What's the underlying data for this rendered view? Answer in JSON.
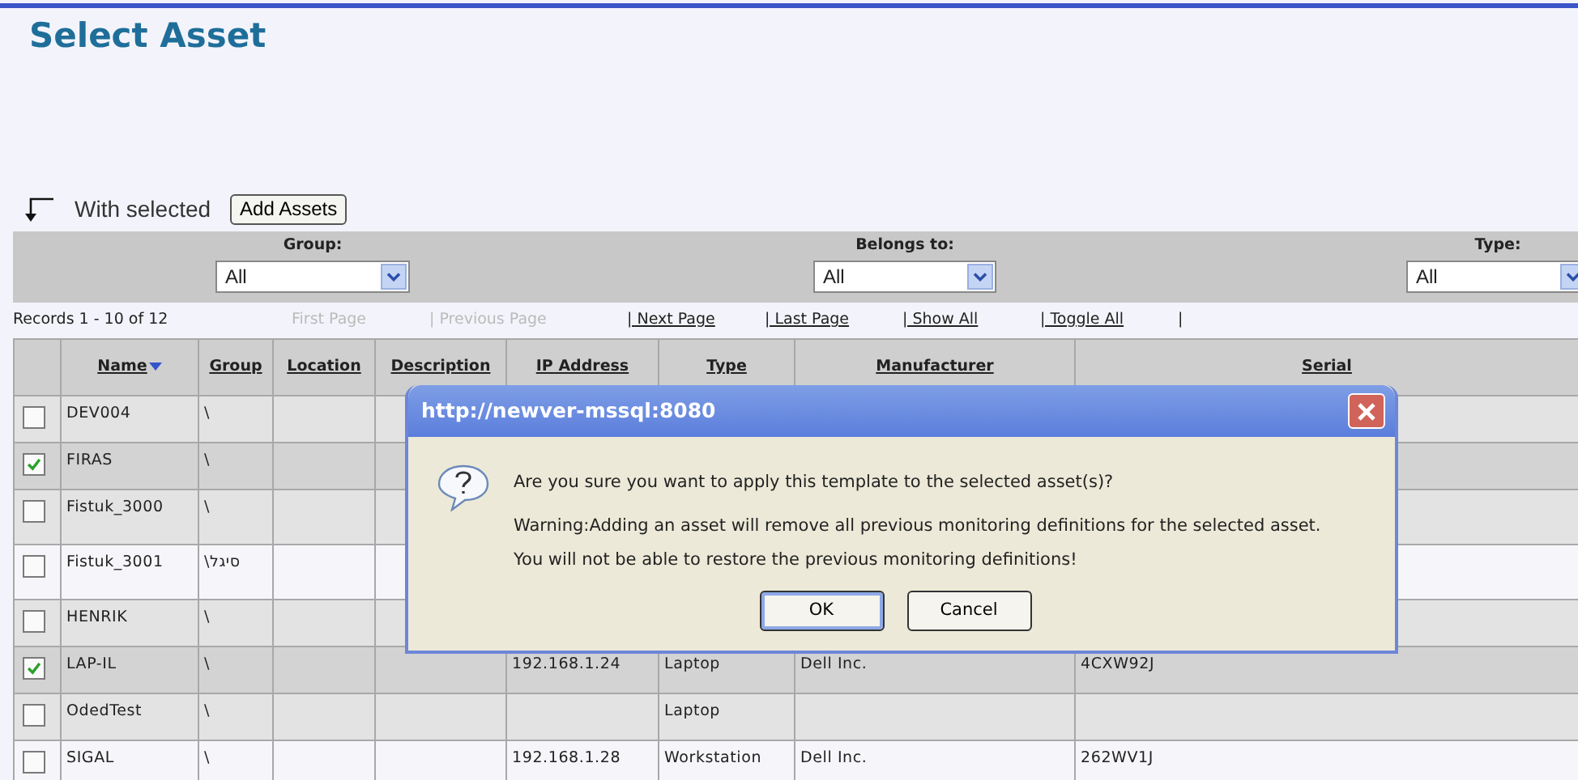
{
  "page": {
    "title": "Select Asset"
  },
  "bulk_action": {
    "label": "With selected",
    "button": "Add Assets"
  },
  "filters": [
    {
      "label": "Group:",
      "value": "All"
    },
    {
      "label": "Belongs to:",
      "value": "All"
    },
    {
      "label": "Type:",
      "value": "All"
    }
  ],
  "pager": {
    "records": "Records 1 - 10 of 12",
    "links": [
      {
        "label": "First Page",
        "disabled": true
      },
      {
        "label": "| Previous Page",
        "disabled": true
      },
      {
        "label": "| Next Page",
        "disabled": false
      },
      {
        "label": "| Last Page",
        "disabled": false
      },
      {
        "label": "| Show All",
        "disabled": false
      },
      {
        "label": "| Toggle All",
        "disabled": false
      }
    ],
    "end": "|"
  },
  "table": {
    "columns": [
      {
        "label": "Name",
        "sorted": true
      },
      {
        "label": "Group",
        "sorted": false
      },
      {
        "label": "Location",
        "sorted": false
      },
      {
        "label": "Description",
        "sorted": false
      },
      {
        "label": "IP Address",
        "sorted": false
      },
      {
        "label": "Type",
        "sorted": false
      },
      {
        "label": "Manufacturer",
        "sorted": false
      },
      {
        "label": "Serial",
        "sorted": false
      }
    ],
    "rows": [
      {
        "checked": false,
        "cells": [
          "DEV004",
          "\\",
          "",
          "",
          "",
          "",
          "",
          ""
        ]
      },
      {
        "checked": true,
        "cells": [
          "FIRAS",
          "\\",
          "",
          "",
          "",
          "",
          "",
          ""
        ]
      },
      {
        "checked": false,
        "cells": [
          "Fistuk_3000",
          "\\",
          "",
          "",
          "",
          "",
          "",
          ""
        ]
      },
      {
        "checked": false,
        "cells": [
          "Fistuk_3001",
          "\\סיגל",
          "",
          "",
          "",
          "",
          "",
          ""
        ]
      },
      {
        "checked": false,
        "cells": [
          "HENRIK",
          "\\",
          "",
          "",
          "",
          "",
          "",
          ""
        ]
      },
      {
        "checked": true,
        "cells": [
          "LAP-IL",
          "\\",
          "",
          "",
          "192.168.1.24",
          "Laptop",
          "Dell Inc.",
          "4CXW92J"
        ]
      },
      {
        "checked": false,
        "cells": [
          "OdedTest",
          "\\",
          "",
          "",
          "",
          "Laptop",
          "",
          ""
        ]
      },
      {
        "checked": false,
        "cells": [
          "SIGAL",
          "\\",
          "",
          "",
          "192.168.1.28",
          "Workstation",
          "Dell Inc.",
          "262WV1J"
        ]
      }
    ]
  },
  "dialog": {
    "title": "http://newver-mssql:8080",
    "message": "Are you sure you want to apply this template to the selected asset(s)?",
    "warning_lines": [
      "Warning:Adding an asset will remove all previous monitoring definitions for the selected asset.",
      "You will not be able to restore the previous monitoring definitions!"
    ],
    "buttons": [
      {
        "label": "OK",
        "default": true
      },
      {
        "label": "Cancel",
        "default": false
      }
    ]
  }
}
